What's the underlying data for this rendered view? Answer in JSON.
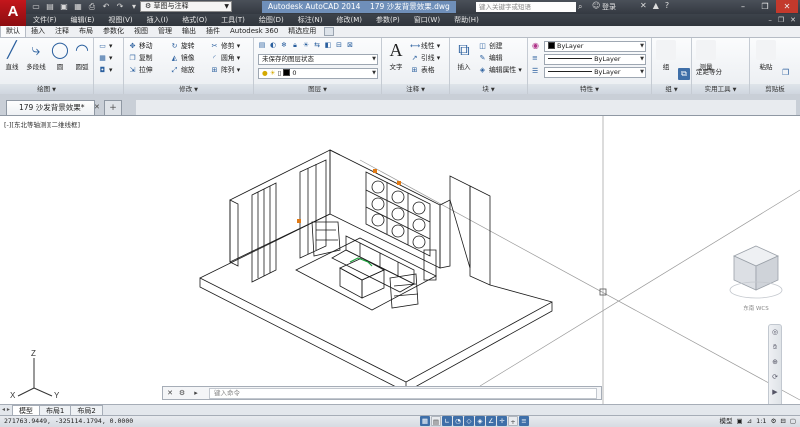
{
  "app": {
    "logo": "A",
    "name": "Autodesk AutoCAD 2014",
    "document": "179 沙发背景效果.dwg"
  },
  "title_bar": {
    "workspace": "草图与注释",
    "search_placeholder": "键入关键字或短语",
    "login": "登录"
  },
  "menu": [
    "文件(F)",
    "编辑(E)",
    "视图(V)",
    "插入(I)",
    "格式(O)",
    "工具(T)",
    "绘图(D)",
    "标注(N)",
    "修改(M)",
    "参数(P)",
    "窗口(W)",
    "帮助(H)"
  ],
  "ribbon_tabs": [
    "默认",
    "插入",
    "注释",
    "布局",
    "参数化",
    "视图",
    "管理",
    "输出",
    "插件",
    "Autodesk 360",
    "精选应用"
  ],
  "panels": {
    "draw": {
      "title": "绘图",
      "big": [
        {
          "label": "直线",
          "icon": "line-icon"
        },
        {
          "label": "多段线",
          "icon": "polyline-icon"
        },
        {
          "label": "圆",
          "icon": "circle-icon"
        },
        {
          "label": "圆弧",
          "icon": "arc-icon"
        }
      ]
    },
    "modify": {
      "title": "修改",
      "rows": [
        [
          "移动",
          "旋转",
          "修剪"
        ],
        [
          "复制",
          "镜像",
          "圆角"
        ],
        [
          "拉伸",
          "缩放",
          "阵列"
        ]
      ]
    },
    "layers": {
      "title": "图层",
      "state": "未保存的图层状态",
      "current": "0"
    },
    "annotation": {
      "title": "注释",
      "big": "文字",
      "rows": [
        "线性",
        "引线",
        "表格"
      ]
    },
    "block": {
      "title": "块",
      "big": "插入",
      "rows": [
        "创建",
        "编辑",
        "编辑属性"
      ]
    },
    "properties": {
      "title": "特性",
      "color": "ByLayer",
      "linetype": "ByLayer",
      "lineweight": "ByLayer"
    },
    "group": {
      "title": "组",
      "label": "组"
    },
    "utilities": {
      "title": "实用工具",
      "label": "测量",
      "sub": "定距等分"
    },
    "clipboard": {
      "title": "剪贴板",
      "label": "粘贴"
    }
  },
  "file_tab": {
    "label": "179 沙发背景效果*"
  },
  "viewport": {
    "label": "[-][东北等轴测][二维线框]",
    "compass": "东南 WCS"
  },
  "ucs": {
    "x": "X",
    "y": "Y",
    "z": "Z"
  },
  "command_line": {
    "placeholder": "键入命令"
  },
  "layout_tabs": [
    "模型",
    "布局1",
    "布局2"
  ],
  "status_bar": {
    "coords": "271763.9449, -325114.1794, 0.0000",
    "space": "模型",
    "scale": "1:1"
  },
  "colors": {
    "title_bar": "#343941",
    "ribbon": "#eef0f3",
    "accent": "#3f6fa8",
    "logo": "#c4161c"
  }
}
